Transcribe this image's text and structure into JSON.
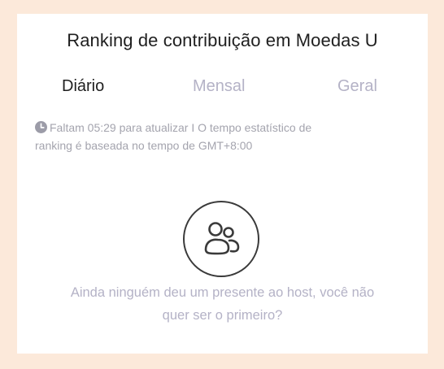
{
  "header": {
    "title": "Ranking de contribuição em Moedas U"
  },
  "tabs": [
    {
      "label": "Diário",
      "active": true
    },
    {
      "label": "Mensal",
      "active": false
    },
    {
      "label": "Geral",
      "active": false
    }
  ],
  "notice": {
    "icon": "clock-icon",
    "line1": "Faltam 05:29 para  atualizar I O tempo estatístico de",
    "line2": "ranking é baseada no tempo de  GMT+8:00"
  },
  "empty_state": {
    "icon": "users-icon",
    "line1": "Ainda ninguém deu um presente ao host, você não",
    "line2": "quer ser o primeiro?"
  },
  "colors": {
    "background": "#fce9da",
    "panel": "#ffffff",
    "active_tab": "#1f1f1f",
    "inactive_tab": "#b4b2c6",
    "muted_text": "#a4a4ae"
  }
}
